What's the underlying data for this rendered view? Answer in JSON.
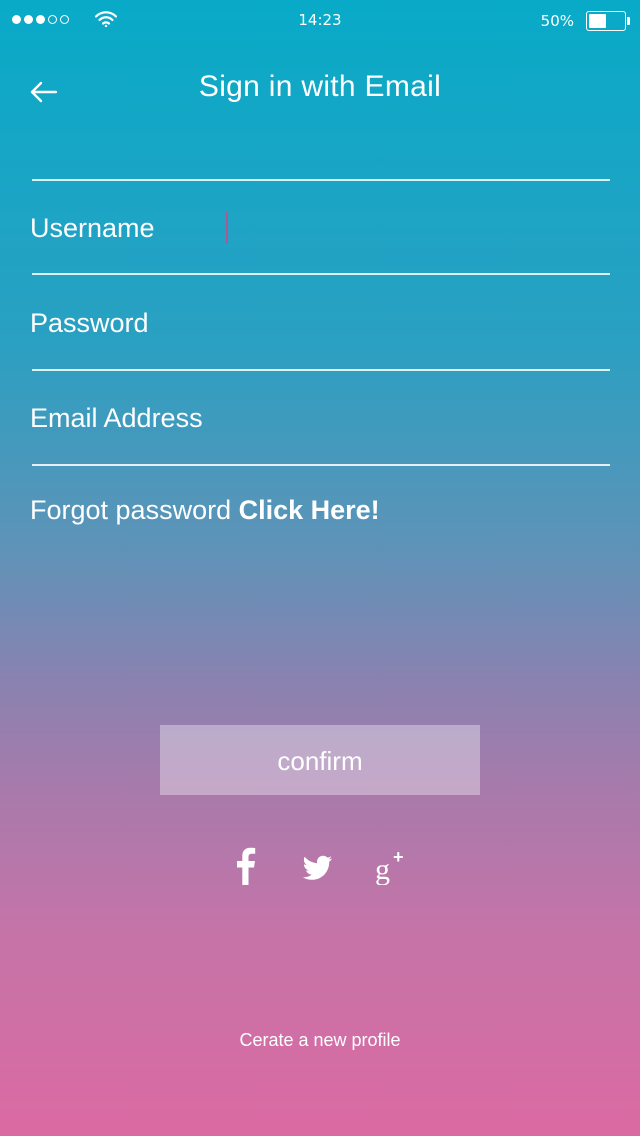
{
  "status_bar": {
    "signal_dots": [
      true,
      true,
      true,
      false,
      false
    ],
    "time": "14:23",
    "battery_text": "50%",
    "battery_level": 0.5
  },
  "header": {
    "title": "Sign in with Email",
    "back_icon": "arrow-left-icon"
  },
  "form": {
    "fields": [
      {
        "label": "Username",
        "value": "",
        "focused": true
      },
      {
        "label": "Password",
        "value": ""
      },
      {
        "label": "Email Address",
        "value": ""
      }
    ],
    "forgot_text": "Forgot password",
    "forgot_link": "Click Here!",
    "confirm_label": "confirm"
  },
  "social": {
    "icons": [
      "facebook-icon",
      "twitter-icon",
      "google-plus-icon"
    ]
  },
  "footer": {
    "create_profile": "Cerate a new profile"
  },
  "colors": {
    "gradient_top": "#08aac8",
    "gradient_bottom": "#db6aa2",
    "caret": "#b0588f"
  }
}
